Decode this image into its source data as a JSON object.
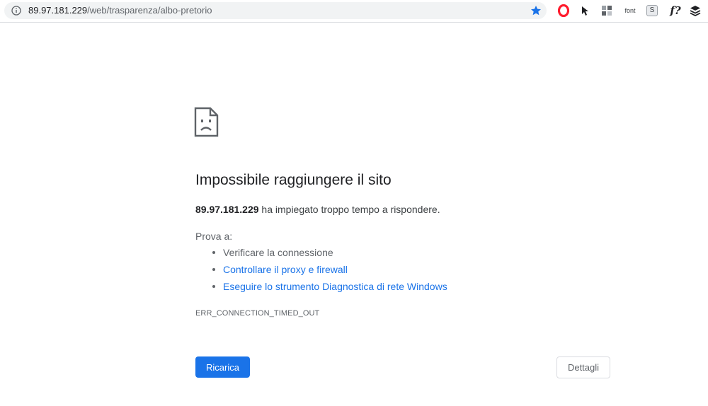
{
  "browser": {
    "url_host": "89.97.181.229",
    "url_path": "/web/trasparenza/albo-pretorio",
    "site_info_icon": "info-icon",
    "bookmark_icon": "star-icon",
    "star_color": "#1a73e8",
    "extensions": [
      {
        "icon": "opera-icon",
        "label": ""
      },
      {
        "icon": "cursor-icon",
        "label": ""
      },
      {
        "icon": "puzzle-icon",
        "label": ""
      },
      {
        "icon": "font-icon",
        "label": "font"
      },
      {
        "icon": "s-icon",
        "label": "S"
      },
      {
        "icon": "function-icon",
        "label": "f?"
      },
      {
        "icon": "layers-icon",
        "label": ""
      }
    ]
  },
  "error_page": {
    "icon": "sad-document-icon",
    "title": "Impossibile raggiungere il sito",
    "host": "89.97.181.229",
    "message": " ha impiegato troppo tempo a rispondere.",
    "try_label": "Prova a:",
    "suggestions": [
      {
        "text": "Verificare la connessione",
        "link": false
      },
      {
        "text": "Controllare il proxy e firewall",
        "link": true
      },
      {
        "text": "Eseguire lo strumento Diagnostica di rete Windows",
        "link": true
      }
    ],
    "error_code": "ERR_CONNECTION_TIMED_OUT",
    "reload_label": "Ricarica",
    "details_label": "Dettagli"
  },
  "colors": {
    "accent": "#1a73e8",
    "text": "#202124",
    "secondary_text": "#5f6368"
  }
}
